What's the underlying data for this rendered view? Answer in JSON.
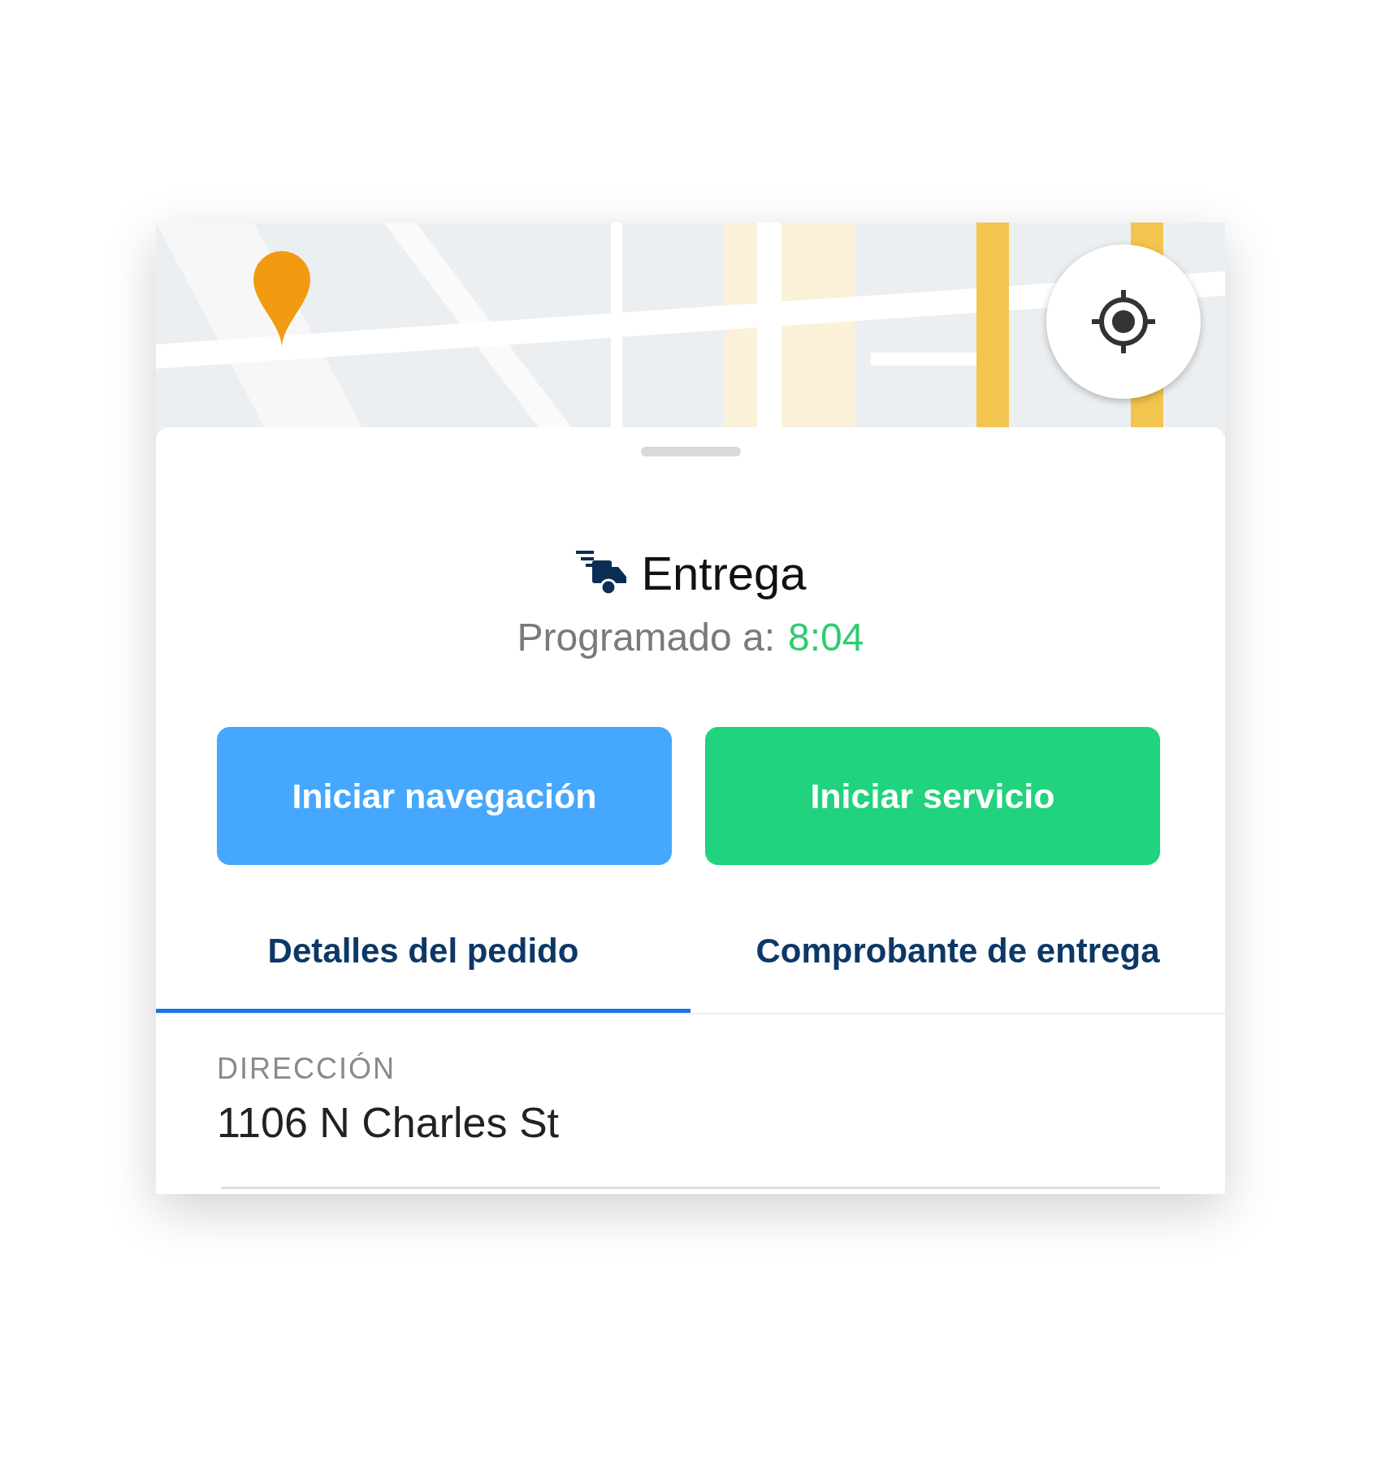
{
  "header": {
    "title": "Entrega",
    "schedule_label": "Programado a:",
    "schedule_time": "8:04"
  },
  "buttons": [
    {
      "label": "Iniciar navegación",
      "kind": "navigate"
    },
    {
      "label": "Iniciar servicio",
      "kind": "service"
    }
  ],
  "tabs": [
    {
      "label": "Detalles del pedido",
      "selected": true
    },
    {
      "label": "Comprobante de entrega",
      "selected": false
    }
  ],
  "fields": [
    {
      "label": "DIRECCIÓN",
      "value": "1106 N Charles St"
    }
  ]
}
